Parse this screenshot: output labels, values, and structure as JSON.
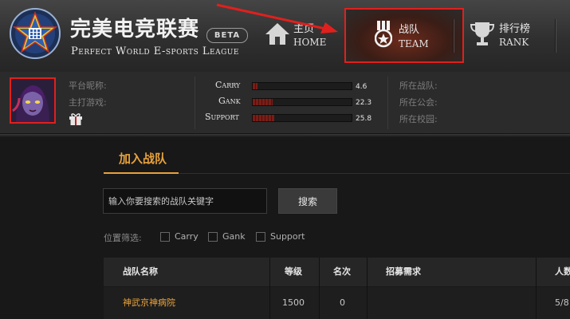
{
  "header": {
    "brand_cn": "完美电竞联赛",
    "beta": "BETA",
    "brand_en": "Perfect World E-sports League",
    "nav": [
      {
        "cn": "主页",
        "en": "HOME"
      },
      {
        "cn": "战队",
        "en": "TEAM"
      },
      {
        "cn": "排行榜",
        "en": "RANK"
      }
    ]
  },
  "user": {
    "nickname_label": "平台昵称:",
    "game_label": "主打游戏:",
    "stats": [
      {
        "name": "Carry",
        "value": "4.6",
        "fill": 0.05
      },
      {
        "name": "Gank",
        "value": "22.3",
        "fill": 0.2
      },
      {
        "name": "Support",
        "value": "25.8",
        "fill": 0.22
      }
    ],
    "team_label": "所在战队:",
    "guild_label": "所在公会:",
    "school_label": "所在校园:"
  },
  "main": {
    "tab": "加入战队",
    "search_placeholder": "输入你要搜索的战队关键字",
    "search_button": "搜索",
    "filter_label": "位置筛选:",
    "filters": [
      "Carry",
      "Gank",
      "Support"
    ],
    "table": {
      "headers": [
        "战队名称",
        "等级",
        "名次",
        "招募需求",
        "人数"
      ],
      "rows": [
        {
          "name": "神武京神病院",
          "level": "1500",
          "rank": "0",
          "need": "",
          "members": "5/8"
        }
      ]
    }
  },
  "colors": {
    "accent": "#e8a23c",
    "highlight": "#e0201d",
    "stat_bar": "#7a1d16"
  }
}
